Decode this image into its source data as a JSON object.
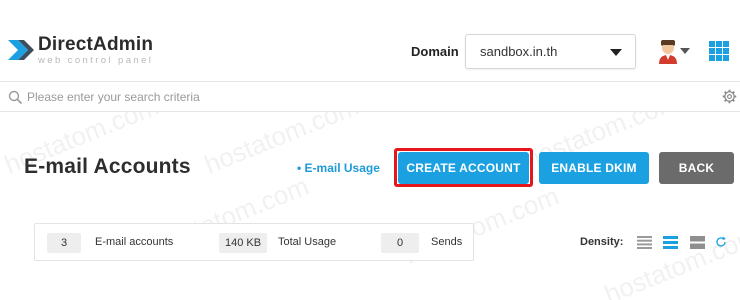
{
  "header": {
    "brand_title": "DirectAdmin",
    "brand_subtitle": "web control panel",
    "domain_label": "Domain",
    "domain_value": "sandbox.in.th"
  },
  "search": {
    "placeholder": "Please enter your search criteria"
  },
  "page": {
    "title": "E-mail Accounts",
    "usage_link": "• E-mail Usage"
  },
  "actions": {
    "create_label": "CREATE ACCOUNT",
    "dkim_label": "ENABLE DKIM",
    "back_label": "BACK"
  },
  "stats": {
    "accounts_count": "3",
    "accounts_label": "E-mail accounts",
    "usage_value": "140 KB",
    "usage_label": "Total Usage",
    "sends_value": "0",
    "sends_label": "Sends"
  },
  "density": {
    "label": "Density:",
    "options": [
      "compact",
      "normal",
      "comfortable"
    ],
    "selected": "normal"
  },
  "watermark": {
    "text": "hostatom.com"
  },
  "colors": {
    "accent": "#1ba1e2",
    "back_button": "#6b6b6b",
    "highlight": "#e5161d"
  },
  "icons": {
    "logo": "directadmin-logo-icon",
    "domain_caret": "chevron-down-icon",
    "avatar": "user-avatar-icon",
    "apps": "apps-grid-icon",
    "search": "search-icon",
    "settings": "gear-icon",
    "refresh": "refresh-icon"
  }
}
